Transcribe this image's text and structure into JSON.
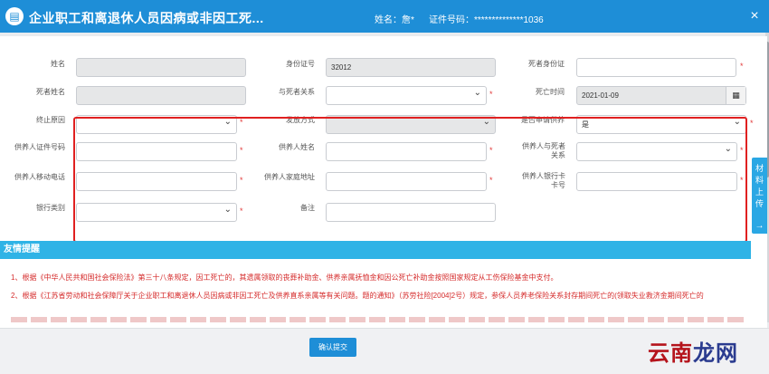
{
  "window": {
    "title": "企业职工和离退休人员因病或非因工死...",
    "name_label": "姓名：",
    "name_value": "詹*",
    "id_label": "证件号码：",
    "id_value": "**************1036",
    "close_glyph": "×"
  },
  "form": {
    "name": {
      "label": "姓名",
      "value": ""
    },
    "id_number": {
      "label": "身份证号",
      "value": "32012"
    },
    "deceased_id": {
      "label": "死者身份证",
      "value": ""
    },
    "deceased_name": {
      "label": "死者姓名",
      "value": ""
    },
    "relation": {
      "label": "与死者关系",
      "value": ""
    },
    "death_time": {
      "label": "死亡时间",
      "value": "2021-01-09"
    },
    "termination_reason": {
      "label": "终止原因",
      "value": ""
    },
    "payment_method": {
      "label": "发放方式",
      "value": ""
    },
    "is_dependent": {
      "label": "是否申请供养",
      "value": "是"
    },
    "dependent_id": {
      "label": "供养人证件号码",
      "value": ""
    },
    "dependent_name": {
      "label": "供养人姓名",
      "value": ""
    },
    "dependent_relation": {
      "label": "供养人与死者关系",
      "value": ""
    },
    "dependent_phone": {
      "label": "供养人移动电话",
      "value": ""
    },
    "dependent_address": {
      "label": "供养人家庭地址",
      "value": ""
    },
    "dependent_bank_card": {
      "label": "供养人银行卡卡号",
      "value": ""
    },
    "bank_type": {
      "label": "银行类别",
      "value": ""
    },
    "remark": {
      "label": "备注",
      "value": ""
    }
  },
  "tips": {
    "header": "友情提醒",
    "items": [
      "1、根据《中华人民共和国社会保险法》第三十八条规定，因工死亡的，其遗属领取的丧葬补助金、供养亲属抚恤金和因公死亡补助金按照国家规定从工伤保险基金中支付。",
      "2、根据《江苏省劳动和社会保障厅关于企业职工和离退休人员因病或非因工死亡及供养直系亲属等有关问题。题的通知》（苏劳社险[2004]2号）规定，参保人员养老保险关系封存期间死亡的(领取失业救济金期间死亡的"
    ]
  },
  "actions": {
    "submit": "确认提交"
  },
  "side_tab": {
    "label": "材料上传",
    "arrow": "→"
  },
  "watermark": {
    "part1": "云南",
    "part2": "龙网"
  },
  "colors": {
    "primary": "#1e8ed7",
    "tips_bar": "#2fb3e6",
    "required": "#e23b3b",
    "highlight_frame": "#e02020"
  }
}
